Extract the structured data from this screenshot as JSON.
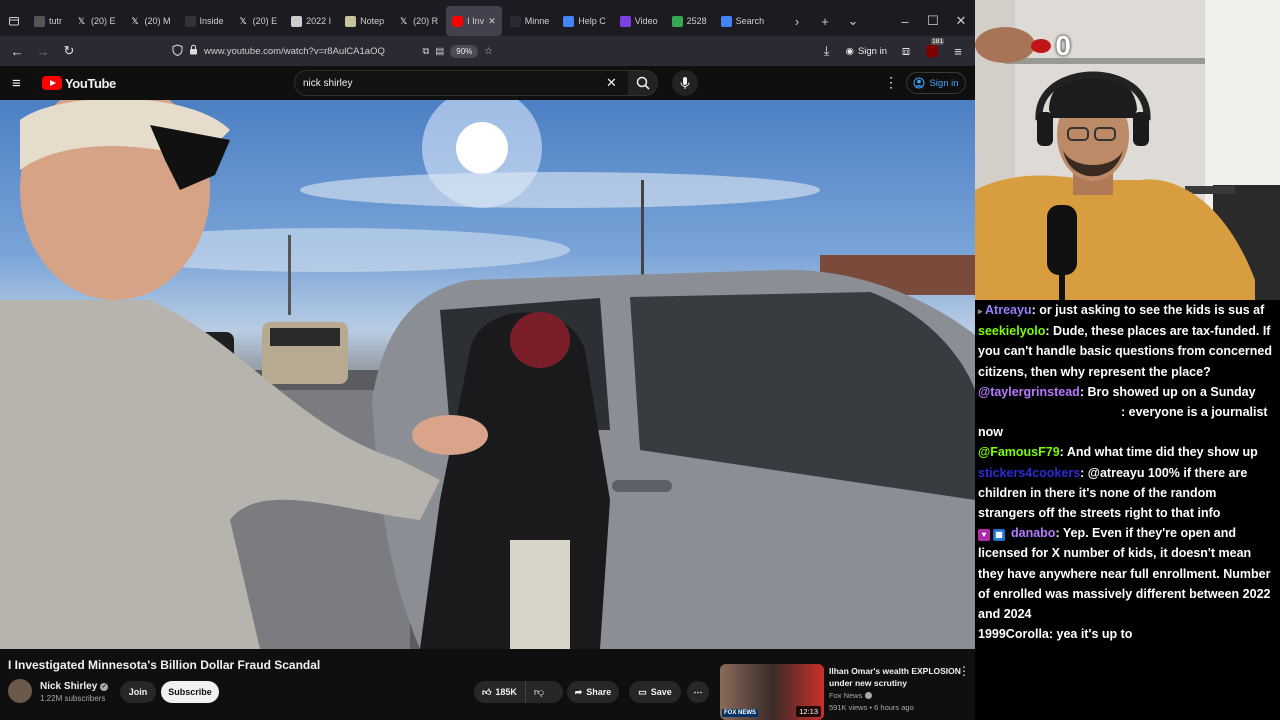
{
  "browser": {
    "tabs": [
      {
        "label": "tutr",
        "icon": "tab-group-icon",
        "color": "#555"
      },
      {
        "label": "(20) E",
        "icon": "x-icon",
        "color": "#000"
      },
      {
        "label": "(20) M",
        "icon": "x-icon",
        "color": "#000"
      },
      {
        "label": "Inside",
        "icon": "e-icon",
        "color": "#333"
      },
      {
        "label": "(20) E",
        "icon": "x-icon",
        "color": "#000"
      },
      {
        "label": "2022 I",
        "icon": "doc-icon",
        "color": "#ccc"
      },
      {
        "label": "Notep",
        "icon": "notepad-icon",
        "color": "#c8c19a"
      },
      {
        "label": "(20) R",
        "icon": "x-icon",
        "color": "#000"
      },
      {
        "label": "I Inv",
        "icon": "youtube-icon",
        "color": "#ff0000",
        "active": true
      },
      {
        "label": "Minne",
        "icon": "blank-icon",
        "color": "#2b2a33"
      },
      {
        "label": "Help C",
        "icon": "mail-icon",
        "color": "#4285f4"
      },
      {
        "label": "Video",
        "icon": "video-icon",
        "color": "#7b3fe4"
      },
      {
        "label": "2528 ",
        "icon": "maps-icon",
        "color": "#34a853"
      },
      {
        "label": "Search",
        "icon": "search-tab-icon",
        "color": "#4285f4"
      }
    ],
    "url": "www.youtube.com/watch?v=r8AulCA1aOQ",
    "zoom": "90%",
    "signin": "Sign in",
    "ext_badge": "181"
  },
  "youtube": {
    "logo_text": "YouTube",
    "search_value": "nick shirley",
    "signin": "Sign in",
    "video_title": "I Investigated Minnesota's Billion Dollar Fraud Scandal",
    "channel": "Nick Shirley",
    "subscribers": "1.22M subscribers",
    "join": "Join",
    "subscribe": "Subscribe",
    "likes": "185K",
    "share": "Share",
    "save": "Save",
    "rec": {
      "title_line1": "Ilhan Omar's wealth EXPLOSION",
      "title_line2": "under new scrutiny",
      "channel": "Fox News",
      "meta": "591K views • 6 hours ago",
      "duration": "12:13",
      "thumb_text": "FOX NEWS"
    }
  },
  "webcam": {
    "overlay_number": "0"
  },
  "chat": [
    {
      "user": "Atreayu",
      "color": "#9b7bff",
      "text": ": or just asking to see the kids is sus af",
      "badge": "arrow"
    },
    {
      "user": "seekielyolo",
      "color": "#7cfc00",
      "text": ": Dude, these places are tax-funded. If you can't handle basic questions from concerned citizens, then why represent the place?"
    },
    {
      "user": "@taylergrinstead",
      "color": "#b57bff",
      "text": ": Bro showed up on a Sunday"
    },
    {
      "user": "",
      "color": "#ffffff",
      "text": ": everyone is a journalist now",
      "indent": true
    },
    {
      "user": "@FamousF79",
      "color": "#7cfc00",
      "text": ": And what time did they show up"
    },
    {
      "user": "stickers4cookers",
      "color": "#2b2bd8",
      "text": ": @atreayu 100% if there are children in there it's none of the random strangers off the streets right to that info"
    },
    {
      "user": "danabo",
      "color": "#b57bff",
      "text": ": Yep. Even if they're open and licensed for X number of kids, it doesn't mean they have anywhere near full enrollment. Number of enrolled was massively different between 2022 and 2024",
      "badges": true
    },
    {
      "user": "1999Corolla",
      "color": "#ffffff",
      "text": ": yea it's up to"
    }
  ]
}
